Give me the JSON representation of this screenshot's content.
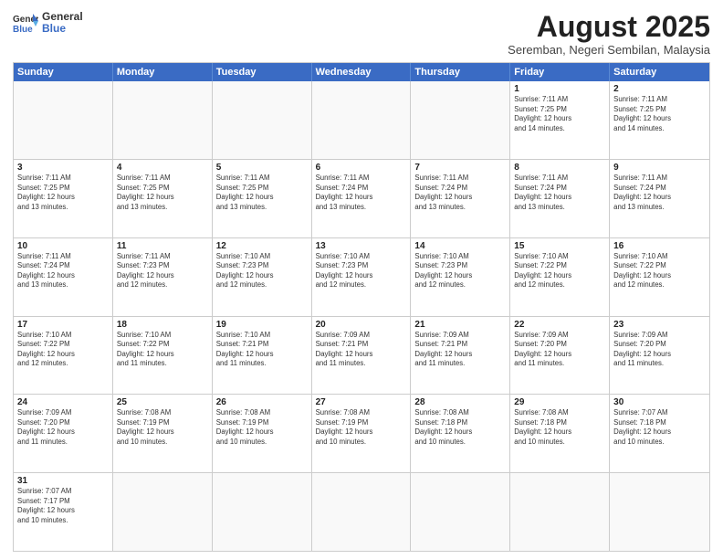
{
  "header": {
    "logo_line1": "General",
    "logo_line2": "Blue",
    "title": "August 2025",
    "subtitle": "Seremban, Negeri Sembilan, Malaysia"
  },
  "weekdays": [
    "Sunday",
    "Monday",
    "Tuesday",
    "Wednesday",
    "Thursday",
    "Friday",
    "Saturday"
  ],
  "weeks": [
    [
      {
        "day": "",
        "info": ""
      },
      {
        "day": "",
        "info": ""
      },
      {
        "day": "",
        "info": ""
      },
      {
        "day": "",
        "info": ""
      },
      {
        "day": "",
        "info": ""
      },
      {
        "day": "1",
        "info": "Sunrise: 7:11 AM\nSunset: 7:25 PM\nDaylight: 12 hours\nand 14 minutes."
      },
      {
        "day": "2",
        "info": "Sunrise: 7:11 AM\nSunset: 7:25 PM\nDaylight: 12 hours\nand 14 minutes."
      }
    ],
    [
      {
        "day": "3",
        "info": "Sunrise: 7:11 AM\nSunset: 7:25 PM\nDaylight: 12 hours\nand 13 minutes."
      },
      {
        "day": "4",
        "info": "Sunrise: 7:11 AM\nSunset: 7:25 PM\nDaylight: 12 hours\nand 13 minutes."
      },
      {
        "day": "5",
        "info": "Sunrise: 7:11 AM\nSunset: 7:25 PM\nDaylight: 12 hours\nand 13 minutes."
      },
      {
        "day": "6",
        "info": "Sunrise: 7:11 AM\nSunset: 7:24 PM\nDaylight: 12 hours\nand 13 minutes."
      },
      {
        "day": "7",
        "info": "Sunrise: 7:11 AM\nSunset: 7:24 PM\nDaylight: 12 hours\nand 13 minutes."
      },
      {
        "day": "8",
        "info": "Sunrise: 7:11 AM\nSunset: 7:24 PM\nDaylight: 12 hours\nand 13 minutes."
      },
      {
        "day": "9",
        "info": "Sunrise: 7:11 AM\nSunset: 7:24 PM\nDaylight: 12 hours\nand 13 minutes."
      }
    ],
    [
      {
        "day": "10",
        "info": "Sunrise: 7:11 AM\nSunset: 7:24 PM\nDaylight: 12 hours\nand 13 minutes."
      },
      {
        "day": "11",
        "info": "Sunrise: 7:11 AM\nSunset: 7:23 PM\nDaylight: 12 hours\nand 12 minutes."
      },
      {
        "day": "12",
        "info": "Sunrise: 7:10 AM\nSunset: 7:23 PM\nDaylight: 12 hours\nand 12 minutes."
      },
      {
        "day": "13",
        "info": "Sunrise: 7:10 AM\nSunset: 7:23 PM\nDaylight: 12 hours\nand 12 minutes."
      },
      {
        "day": "14",
        "info": "Sunrise: 7:10 AM\nSunset: 7:23 PM\nDaylight: 12 hours\nand 12 minutes."
      },
      {
        "day": "15",
        "info": "Sunrise: 7:10 AM\nSunset: 7:22 PM\nDaylight: 12 hours\nand 12 minutes."
      },
      {
        "day": "16",
        "info": "Sunrise: 7:10 AM\nSunset: 7:22 PM\nDaylight: 12 hours\nand 12 minutes."
      }
    ],
    [
      {
        "day": "17",
        "info": "Sunrise: 7:10 AM\nSunset: 7:22 PM\nDaylight: 12 hours\nand 12 minutes."
      },
      {
        "day": "18",
        "info": "Sunrise: 7:10 AM\nSunset: 7:22 PM\nDaylight: 12 hours\nand 11 minutes."
      },
      {
        "day": "19",
        "info": "Sunrise: 7:10 AM\nSunset: 7:21 PM\nDaylight: 12 hours\nand 11 minutes."
      },
      {
        "day": "20",
        "info": "Sunrise: 7:09 AM\nSunset: 7:21 PM\nDaylight: 12 hours\nand 11 minutes."
      },
      {
        "day": "21",
        "info": "Sunrise: 7:09 AM\nSunset: 7:21 PM\nDaylight: 12 hours\nand 11 minutes."
      },
      {
        "day": "22",
        "info": "Sunrise: 7:09 AM\nSunset: 7:20 PM\nDaylight: 12 hours\nand 11 minutes."
      },
      {
        "day": "23",
        "info": "Sunrise: 7:09 AM\nSunset: 7:20 PM\nDaylight: 12 hours\nand 11 minutes."
      }
    ],
    [
      {
        "day": "24",
        "info": "Sunrise: 7:09 AM\nSunset: 7:20 PM\nDaylight: 12 hours\nand 11 minutes."
      },
      {
        "day": "25",
        "info": "Sunrise: 7:08 AM\nSunset: 7:19 PM\nDaylight: 12 hours\nand 10 minutes."
      },
      {
        "day": "26",
        "info": "Sunrise: 7:08 AM\nSunset: 7:19 PM\nDaylight: 12 hours\nand 10 minutes."
      },
      {
        "day": "27",
        "info": "Sunrise: 7:08 AM\nSunset: 7:19 PM\nDaylight: 12 hours\nand 10 minutes."
      },
      {
        "day": "28",
        "info": "Sunrise: 7:08 AM\nSunset: 7:18 PM\nDaylight: 12 hours\nand 10 minutes."
      },
      {
        "day": "29",
        "info": "Sunrise: 7:08 AM\nSunset: 7:18 PM\nDaylight: 12 hours\nand 10 minutes."
      },
      {
        "day": "30",
        "info": "Sunrise: 7:07 AM\nSunset: 7:18 PM\nDaylight: 12 hours\nand 10 minutes."
      }
    ],
    [
      {
        "day": "31",
        "info": "Sunrise: 7:07 AM\nSunset: 7:17 PM\nDaylight: 12 hours\nand 10 minutes."
      },
      {
        "day": "",
        "info": ""
      },
      {
        "day": "",
        "info": ""
      },
      {
        "day": "",
        "info": ""
      },
      {
        "day": "",
        "info": ""
      },
      {
        "day": "",
        "info": ""
      },
      {
        "day": "",
        "info": ""
      }
    ]
  ]
}
